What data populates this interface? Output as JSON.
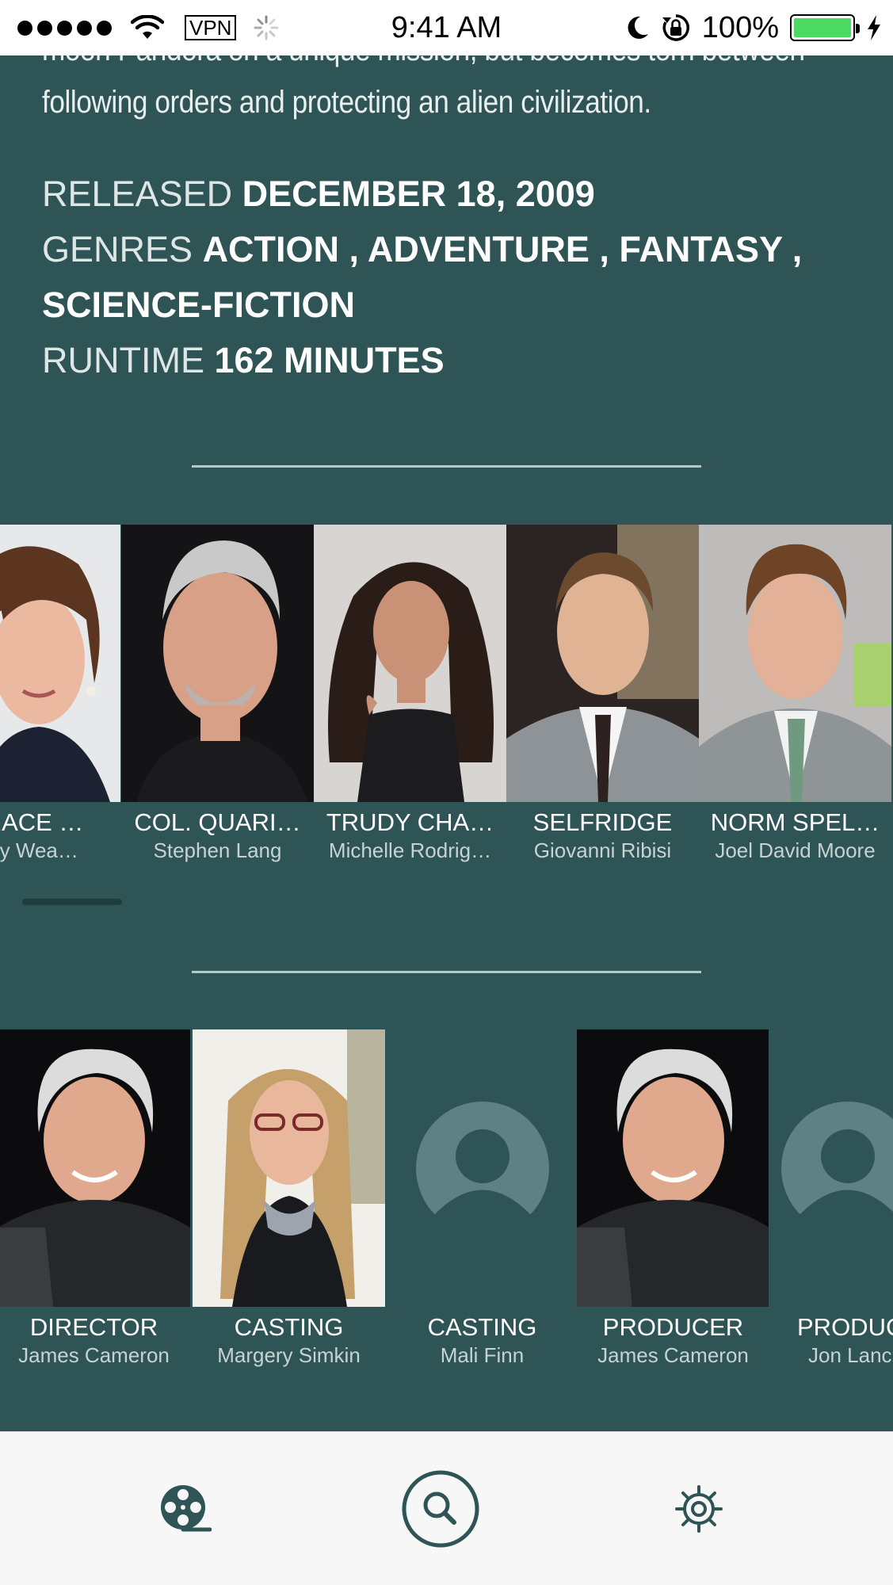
{
  "status_bar": {
    "carrier_signal_dots": 5,
    "vpn_label": "VPN",
    "time": "9:41 AM",
    "battery_percent": "100%",
    "battery_level": 1.0,
    "icons": [
      "wifi-icon",
      "spinner-icon",
      "moon-icon",
      "rotation-lock-icon",
      "battery-icon",
      "charging-bolt-icon"
    ]
  },
  "overview": {
    "line_partial": "moon Pandora on a unique mission, but becomes torn between",
    "line_last": "following orders and protecting an alien civilization."
  },
  "details": {
    "released_label": "RELEASED",
    "released_value": "DECEMBER 18, 2009",
    "genres_label": "GENRES",
    "genres_value_1": "ACTION , ADVENTURE , FANTASY ,",
    "genres_value_2": "SCIENCE-FICTION",
    "runtime_label": "RUNTIME",
    "runtime_value": "162 MINUTES"
  },
  "cast": [
    {
      "name": "GRACE …",
      "actor": "rney Wea…"
    },
    {
      "name": "COL. QUARI…",
      "actor": "Stephen Lang"
    },
    {
      "name": "TRUDY CHA…",
      "actor": "Michelle Rodrig…"
    },
    {
      "name": "SELFRIDGE",
      "actor": "Giovanni Ribisi"
    },
    {
      "name": "NORM SPEL…",
      "actor": "Joel David Moore"
    }
  ],
  "crew": [
    {
      "job": "DIRECTOR",
      "name": "James Cameron",
      "has_photo": true
    },
    {
      "job": "CASTING",
      "name": "Margery Simkin",
      "has_photo": true
    },
    {
      "job": "CASTING",
      "name": "Mali Finn",
      "has_photo": false
    },
    {
      "job": "PRODUCER",
      "name": "James Cameron",
      "has_photo": true
    },
    {
      "job": "PRODUC",
      "name": "Jon Lanc",
      "has_photo": false
    }
  ],
  "tab_bar": {
    "tabs": [
      {
        "icon": "film-reel-icon",
        "selected": false
      },
      {
        "icon": "search-icon",
        "selected": true
      },
      {
        "icon": "gear-icon",
        "selected": false
      }
    ]
  },
  "colors": {
    "background": "#2e5456",
    "tab_accent": "#2e5456",
    "placeholder_avatar": "#5f8183"
  }
}
